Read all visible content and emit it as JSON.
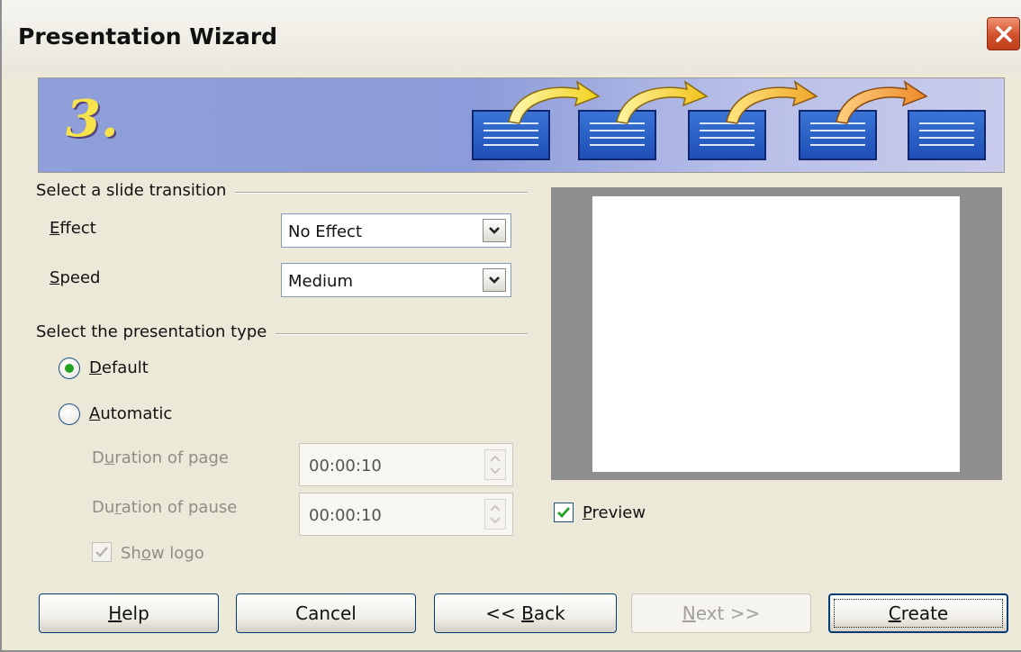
{
  "window": {
    "title": "Presentation Wizard"
  },
  "header": {
    "step_number": "3."
  },
  "transition": {
    "group_title": "Select a slide transition",
    "effect_label_u": "E",
    "effect_label_rest": "ffect",
    "effect_value": "No Effect",
    "speed_label_u": "S",
    "speed_label_rest": "peed",
    "speed_value": "Medium"
  },
  "presentation_type": {
    "group_title": "Select the presentation type",
    "default_label_u": "D",
    "default_label_rest": "efault",
    "default_selected": true,
    "automatic_label_u": "A",
    "automatic_label_rest": "utomatic",
    "duration_page_label_a": "D",
    "duration_page_label_u": "u",
    "duration_page_label_b": "ration of page",
    "duration_page_value": "00:00:10",
    "duration_pause_label_a": "Du",
    "duration_pause_label_u": "r",
    "duration_pause_label_b": "ation of pause",
    "duration_pause_value": "00:00:10",
    "show_logo_label_a": "Sh",
    "show_logo_label_u": "o",
    "show_logo_label_b": "w logo",
    "show_logo_checked": true
  },
  "preview": {
    "checkbox_label_u": "P",
    "checkbox_label_rest": "review",
    "checked": true
  },
  "buttons": {
    "help_u": "H",
    "help_rest": "elp",
    "cancel": "Cancel",
    "back_pre": "<< ",
    "back_u": "B",
    "back_rest": "ack",
    "next_u": "N",
    "next_rest": "ext >>",
    "create_u": "C",
    "create_rest": "reate"
  },
  "colors": {
    "dialog_bg": "#ece9d8",
    "banner_blue": "#8c9bd9",
    "step_yellow": "#f7e34a",
    "radio_green": "#21a121",
    "preview_gray": "#8f8f8f"
  }
}
